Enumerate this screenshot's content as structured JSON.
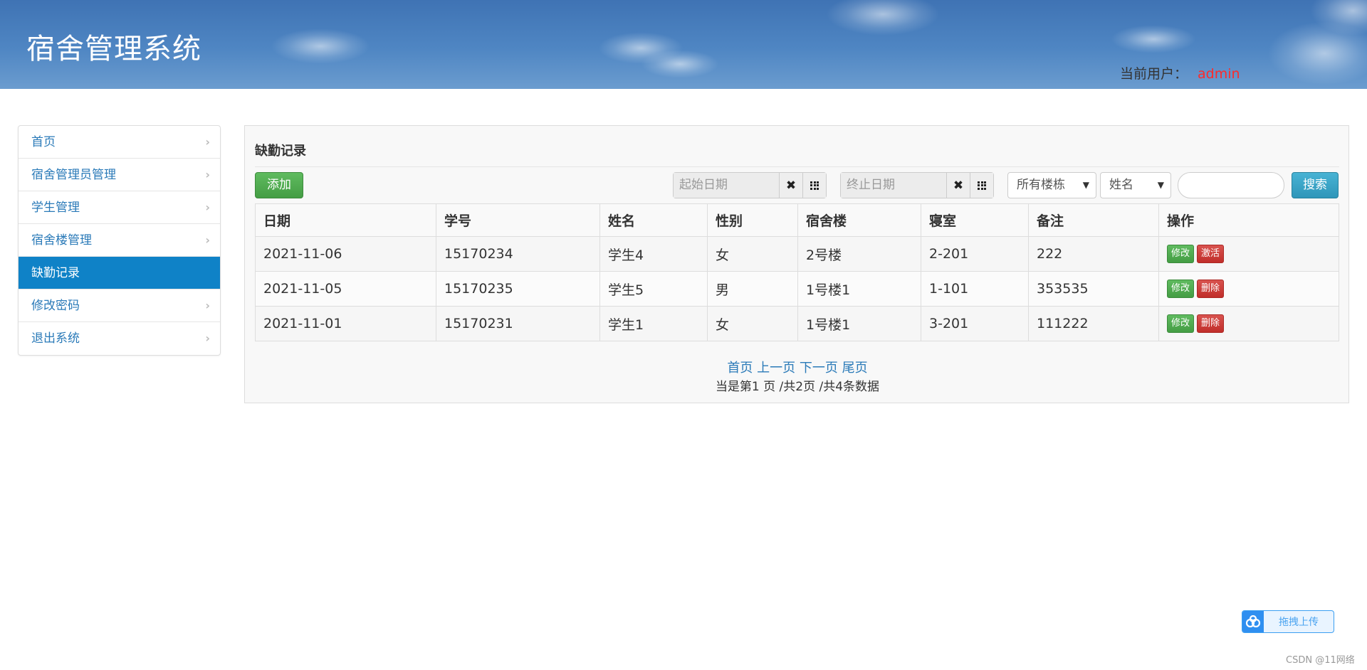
{
  "header": {
    "title": "宿舍管理系统",
    "current_user_label": "当前用户：",
    "current_user_name": "admin"
  },
  "sidebar": {
    "items": [
      {
        "label": "首页",
        "active": false
      },
      {
        "label": "宿舍管理员管理",
        "active": false
      },
      {
        "label": "学生管理",
        "active": false
      },
      {
        "label": "宿舍楼管理",
        "active": false
      },
      {
        "label": "缺勤记录",
        "active": true
      },
      {
        "label": "修改密码",
        "active": false
      },
      {
        "label": "退出系统",
        "active": false
      }
    ]
  },
  "panel": {
    "title": "缺勤记录",
    "add_label": "添加",
    "start_date_placeholder": "起始日期",
    "end_date_placeholder": "终止日期",
    "building_select": "所有楼栋",
    "field_select": "姓名",
    "search_value": "",
    "search_label": "搜索"
  },
  "table": {
    "headers": [
      "日期",
      "学号",
      "姓名",
      "性别",
      "宿舍楼",
      "寝室",
      "备注",
      "操作"
    ],
    "rows": [
      {
        "date": "2021-11-06",
        "sid": "15170234",
        "name": "学生4",
        "gender": "女",
        "building": "2号楼",
        "room": "2-201",
        "note": "222",
        "edit": "修改",
        "action": "激活"
      },
      {
        "date": "2021-11-05",
        "sid": "15170235",
        "name": "学生5",
        "gender": "男",
        "building": "1号楼1",
        "room": "1-101",
        "note": "353535",
        "edit": "修改",
        "action": "删除"
      },
      {
        "date": "2021-11-01",
        "sid": "15170231",
        "name": "学生1",
        "gender": "女",
        "building": "1号楼1",
        "room": "3-201",
        "note": "111222",
        "edit": "修改",
        "action": "删除"
      }
    ]
  },
  "pager": {
    "first": "首页",
    "prev": "上一页",
    "next": "下一页",
    "last": "尾页",
    "info": "当是第1 页 /共2页  /共4条数据"
  },
  "widget": {
    "upload_label": "拖拽上传",
    "watermark": "CSDN @11网络"
  },
  "colors": {
    "accent": "#0f82c7",
    "user_name": "#ff2a2a",
    "link": "#2a7ab8"
  }
}
